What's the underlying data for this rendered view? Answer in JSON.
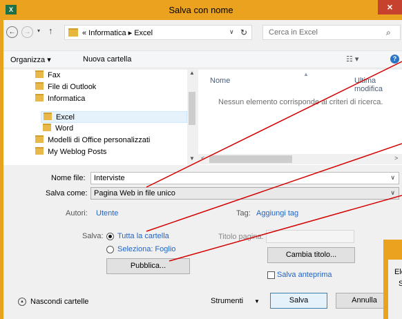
{
  "window": {
    "title": "Salva con nome",
    "app_icon_text": "x̅",
    "close_label": "×",
    "accent_color": "#eba21e",
    "close_color": "#c7412f"
  },
  "nav": {
    "back": "←",
    "forward": "→",
    "dropdown": "▾",
    "up": "↑",
    "address_path": "« Informatica ▸ Excel",
    "address_chevron": "∨",
    "refresh": "↻",
    "search_placeholder": "Cerca in Excel",
    "search_icon": "⌕"
  },
  "toolbar": {
    "organize": "Organizza ▾",
    "new_folder": "Nuova cartella",
    "view": "☷ ▾",
    "help": "?"
  },
  "tree": {
    "items": [
      {
        "label": "Fax",
        "indent": 0
      },
      {
        "label": "File di Outlook",
        "indent": 0
      },
      {
        "label": "Informatica",
        "indent": 0
      },
      {
        "label": "Excel",
        "indent": 1,
        "selected": true
      },
      {
        "label": "Word",
        "indent": 1
      },
      {
        "label": "Modelli di Office personalizzati",
        "indent": 0
      },
      {
        "label": "My Weblog Posts",
        "indent": 0
      }
    ],
    "scroll_up": "▲",
    "scroll_down": "▼"
  },
  "list": {
    "col_name": "Nome",
    "col_modified": "Ultima modifica",
    "sort_indicator": "▲",
    "empty_message": "Nessun elemento corrisponde ai criteri di ricerca.",
    "scroll_left": "<",
    "scroll_right": ">"
  },
  "form": {
    "filename_label": "Nome file:",
    "filename_value": "Interviste",
    "savetype_label": "Salva come:",
    "savetype_value": "Pagina Web in file unico",
    "authors_label": "Autori:",
    "authors_value": "Utente",
    "tags_label": "Tag:",
    "tags_value": "Aggiungi tag",
    "save_label": "Salva:",
    "option_all": "Tutta la cartella",
    "option_selection": "Seleziona: Foglio",
    "publish_button": "Pubblica...",
    "page_title_label": "Titolo pagina:",
    "change_title_button": "Cambia titolo...",
    "preview_label": "Salva anteprima",
    "chevron": "∨"
  },
  "footer": {
    "hide_folders": "Nascondi cartelle",
    "hide_icon": "▲",
    "tools": "Strumenti",
    "tools_drop": "▼",
    "save_button": "Salva",
    "cancel_button": "Annulla"
  },
  "dialog2": {
    "text1": "Ele",
    "text2": "S"
  },
  "annotations": {
    "line_color": "#d40000"
  }
}
